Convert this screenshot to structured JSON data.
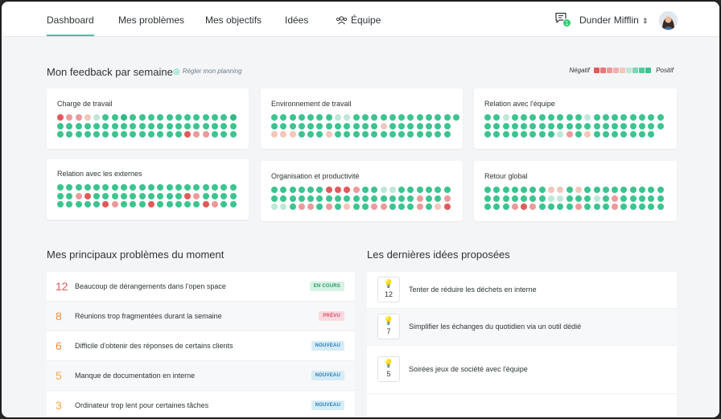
{
  "nav": {
    "tabs": [
      {
        "label": "Dashboard"
      },
      {
        "label": "Mes problèmes"
      },
      {
        "label": "Mes objectifs"
      },
      {
        "label": "Idées"
      },
      {
        "label": "Équipe"
      }
    ],
    "messages_badge": "1",
    "company": "Dunder Mifflin"
  },
  "feedback": {
    "title": "Mon feedback par semaine",
    "planning_link": "Régler mon planning",
    "legend_negative": "Négatif",
    "legend_positive": "Positif",
    "palette": {
      "R": "#e05a5a",
      "r": "#eb9a9a",
      "o": "#f2c6b8",
      "l": "#bfe7d7",
      "g": "#3cc48f",
      "G": "#2fb985"
    },
    "legend_colors": [
      "#e05a5a",
      "#e87777",
      "#eb9a9a",
      "#f0b0b0",
      "#f2c6b8",
      "#bfe7d7",
      "#7fd5b4",
      "#52c99c",
      "#3cc48f"
    ],
    "cards": [
      {
        "title": "Charge de travail",
        "rows": [
          "RrrolggGgggggggggggG",
          "gggggggggggggggggggg",
          "ggggggggggggggRrrggg"
        ]
      },
      {
        "title": "Environnement de travail",
        "rows": [
          "gggggggllgggggggggggg",
          "ggggggggggggoggggggg",
          "ooogggoggggggggggggg"
        ]
      },
      {
        "title": "Relation avec l'équipe",
        "rows": [
          "gglgggggggglgggggggg",
          "gggggggggggggggggggg",
          "gggggggglrgoggggggg"
        ]
      },
      {
        "title": "Relation avec les externes",
        "rows": [
          "gggggggggggggggggggg",
          "ggrRggggggggggRrgggg",
          "gggggRrgggRgggggRrgg"
        ]
      },
      {
        "title": "Organisation et productivité",
        "rows": [
          "ggggggRRRrggllgggggg",
          "ggggggggggggggggrggr",
          "llgrrgrgoggrrgggrgoR"
        ]
      },
      {
        "title": "Retour global",
        "rows": [
          "gggggggoogoggggggggg",
          "gggggggllggglgrggggg",
          "gggrRrggggrgggrggggg"
        ]
      }
    ]
  },
  "problems": {
    "title": "Mes principaux problèmes du moment",
    "items": [
      {
        "count": "12",
        "count_color": "#e05a5a",
        "text": "Beaucoup de dérangements dans l'open space",
        "badge": "EN COURS",
        "badge_bg": "#d6f3e4",
        "badge_fg": "#2a9d6a"
      },
      {
        "count": "8",
        "count_color": "#f08c3a",
        "text": "Réunions trop fragmentées durant la semaine",
        "badge": "PRÉVU",
        "badge_bg": "#fadadf",
        "badge_fg": "#d9506a"
      },
      {
        "count": "6",
        "count_color": "#f08c3a",
        "text": "Difficile d'obtenir des réponses de certains clients",
        "badge": "NOUVEAU",
        "badge_bg": "#d6ecf8",
        "badge_fg": "#2b7fb8"
      },
      {
        "count": "5",
        "count_color": "#f4a94a",
        "text": "Manque de documentation en interne",
        "badge": "NOUVEAU",
        "badge_bg": "#d6ecf8",
        "badge_fg": "#2b7fb8"
      },
      {
        "count": "3",
        "count_color": "#f4a94a",
        "text": "Ordinateur trop lent pour certaines tâches",
        "badge": "NOUVEAU",
        "badge_bg": "#d6ecf8",
        "badge_fg": "#2b7fb8"
      }
    ]
  },
  "ideas": {
    "title": "Les dernières idées proposées",
    "items": [
      {
        "votes": "12",
        "text": "Tenter de réduire les déchets en interne"
      },
      {
        "votes": "7",
        "text": "Simplifier les échanges du quotidien via un outil dédié"
      },
      {
        "votes": "5",
        "text": "Soirées jeux de société avec l'équipe"
      }
    ]
  }
}
